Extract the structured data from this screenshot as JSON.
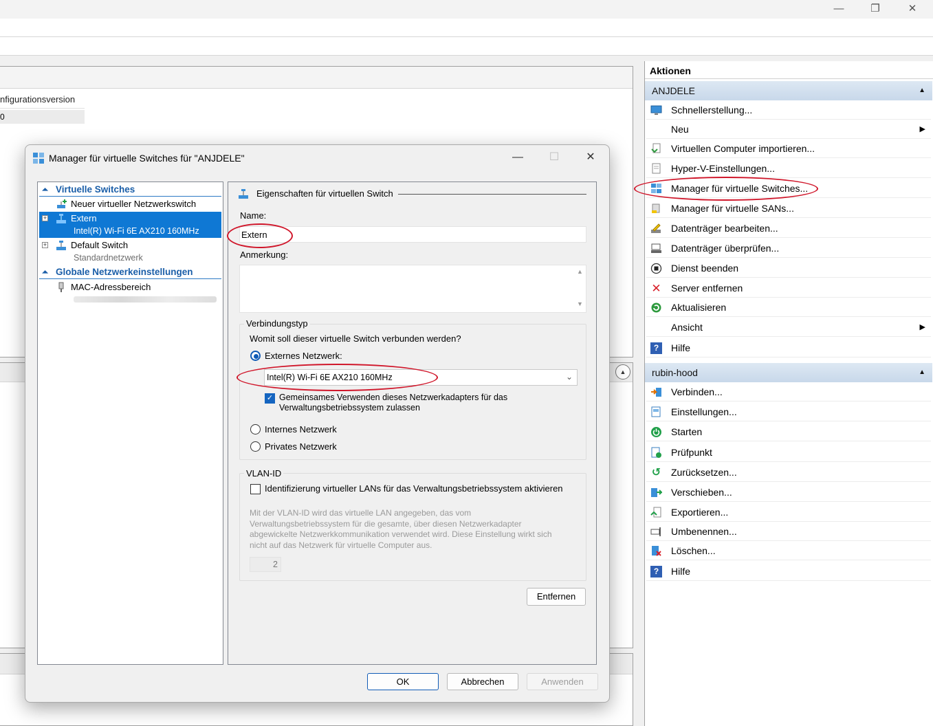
{
  "window": {
    "minimize": "—",
    "restore": "❐",
    "close": "✕"
  },
  "column": {
    "header": "nfigurationsversion",
    "value": "0"
  },
  "actions": {
    "title": "Aktionen",
    "group1": "ANJDELE",
    "group1_items": [
      "Schnellerstellung...",
      "Neu",
      "Virtuellen Computer importieren...",
      "Hyper-V-Einstellungen...",
      "Manager für virtuelle Switches...",
      "Manager für virtuelle SANs...",
      "Datenträger bearbeiten...",
      "Datenträger überprüfen...",
      "Dienst beenden",
      "Server entfernen",
      "Aktualisieren",
      "Ansicht",
      "Hilfe"
    ],
    "group2": "rubin-hood",
    "group2_items": [
      "Verbinden...",
      "Einstellungen...",
      "Starten",
      "Prüfpunkt",
      "Zurücksetzen...",
      "Verschieben...",
      "Exportieren...",
      "Umbenennen...",
      "Löschen...",
      "Hilfe"
    ]
  },
  "dialog": {
    "title": "Manager für virtuelle Switches für \"ANJDELE\"",
    "tree": {
      "section1": "Virtuelle Switches",
      "new_switch": "Neuer virtueller Netzwerkswitch",
      "extern": "Extern",
      "extern_sub": "Intel(R) Wi-Fi 6E AX210 160MHz",
      "default_switch": "Default Switch",
      "default_sub": "Standardnetzwerk",
      "section2": "Globale Netzwerkeinstellungen",
      "mac": "MAC-Adressbereich"
    },
    "props": {
      "heading": "Eigenschaften für virtuellen Switch",
      "name_label": "Name:",
      "name_value": "Extern",
      "note_label": "Anmerkung:",
      "conn_group": "Verbindungstyp",
      "conn_question": "Womit soll dieser virtuelle Switch verbunden werden?",
      "external_label": "Externes Netzwerk:",
      "adapter": "Intel(R) Wi-Fi 6E AX210 160MHz",
      "share_label_1": "Gemeinsames Verwenden dieses Netzwerkadapters für das",
      "share_label_2": "Verwaltungsbetriebssystem zulassen",
      "internal_label": "Internes Netzwerk",
      "private_label": "Privates Netzwerk",
      "vlan_group": "VLAN-ID",
      "vlan_check_label": "Identifizierung virtueller LANs für das Verwaltungsbetriebssystem aktivieren",
      "vlan_desc_1": "Mit der VLAN-ID wird das virtuelle LAN angegeben, das vom",
      "vlan_desc_2": "Verwaltungsbetriebssystem für die gesamte, über diesen Netzwerkadapter",
      "vlan_desc_3": "abgewickelte Netzwerkkommunikation verwendet wird. Diese Einstellung wirkt sich",
      "vlan_desc_4": "nicht auf das Netzwerk für virtuelle Computer aus.",
      "vlan_value": "2",
      "remove_button": "Entfernen"
    },
    "buttons": {
      "ok": "OK",
      "cancel": "Abbrechen",
      "apply": "Anwenden"
    }
  },
  "colors": {
    "accent": "#0f78d4",
    "section_text": "#1a5ea8",
    "highlight_ellipse": "#d0162a",
    "group_header": "#c8d8ea"
  }
}
